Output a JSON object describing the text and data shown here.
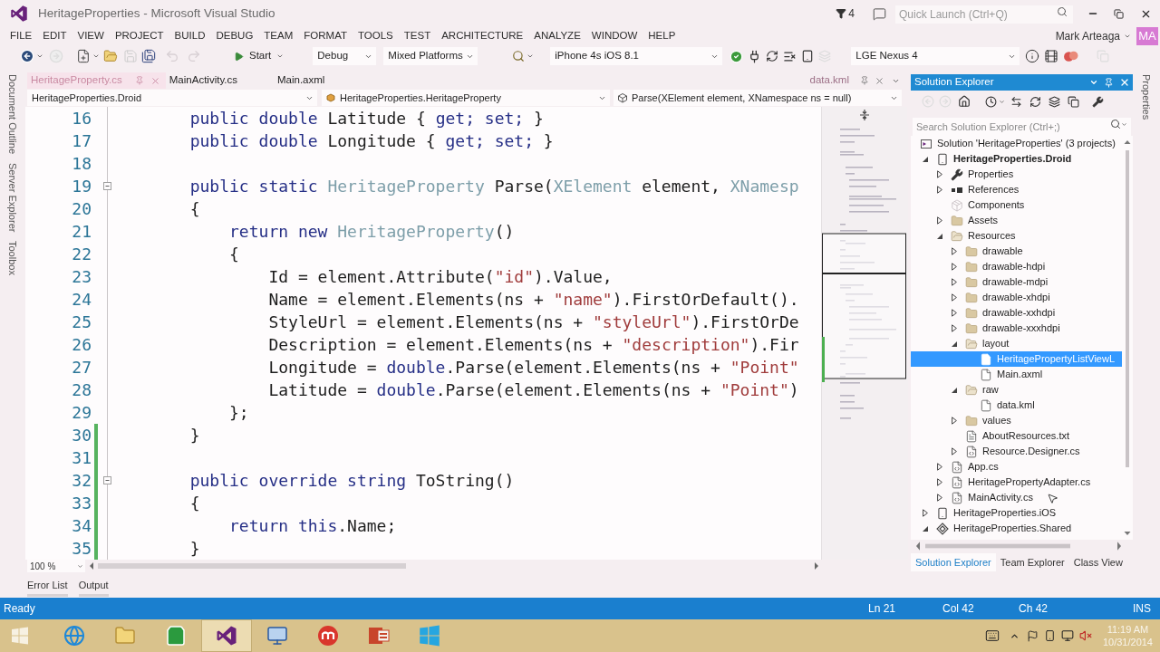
{
  "window": {
    "title": "HeritageProperties - Microsoft Visual Studio",
    "notification_count": "4",
    "quick_launch": {
      "placeholder": "Quick Launch (Ctrl+Q)"
    }
  },
  "menu": [
    "FILE",
    "EDIT",
    "VIEW",
    "PROJECT",
    "BUILD",
    "DEBUG",
    "TEAM",
    "FORMAT",
    "TOOLS",
    "TEST",
    "ARCHITECTURE",
    "ANALYZE",
    "WINDOW",
    "HELP"
  ],
  "account": {
    "name": "Mark Arteaga",
    "initials": "MA"
  },
  "toolbar": {
    "start": "Start",
    "configuration": "Debug",
    "platform": "Mixed Platforms",
    "ios_target": "iPhone 4s iOS 8.1",
    "android_target": "LGE Nexus 4"
  },
  "left_tool_tabs": [
    "Document Outline",
    "Server Explorer",
    "Toolbox"
  ],
  "right_tool_tabs": [
    "Properties"
  ],
  "editor": {
    "tabs": [
      {
        "label": "HeritageProperty.cs",
        "selected": true
      },
      {
        "label": "MainActivity.cs",
        "selected": false
      },
      {
        "label": "Main.axml",
        "selected": false
      }
    ],
    "preview_tab": "data.kml",
    "navigation": [
      "HeritageProperties.Droid",
      "HeritageProperties.HeritageProperty",
      "Parse(XElement element, XNamespace ns = null)"
    ],
    "lines": [
      {
        "number": "16",
        "modified": false,
        "collapsible": false,
        "tokens": [
          {
            "kind": "keyword",
            "text": "        public double"
          },
          {
            "kind": "plain",
            "text": " Latitude { "
          },
          {
            "kind": "keyword",
            "text": "get; set;"
          },
          {
            "kind": "plain",
            "text": " }"
          }
        ]
      },
      {
        "number": "17",
        "modified": false,
        "collapsible": false,
        "tokens": [
          {
            "kind": "keyword",
            "text": "        public double"
          },
          {
            "kind": "plain",
            "text": " Longitude { "
          },
          {
            "kind": "keyword",
            "text": "get; set;"
          },
          {
            "kind": "plain",
            "text": " }"
          }
        ]
      },
      {
        "number": "18",
        "modified": false,
        "collapsible": false
      },
      {
        "number": "19",
        "modified": false,
        "collapsible": true,
        "tokens": [
          {
            "kind": "keyword",
            "text": "        public static "
          },
          {
            "kind": "type",
            "text": "HeritageProperty"
          },
          {
            "kind": "plain",
            "text": " Parse("
          },
          {
            "kind": "type",
            "text": "XElement"
          },
          {
            "kind": "plain",
            "text": " element, "
          },
          {
            "kind": "type",
            "text": "XNamesp"
          }
        ]
      },
      {
        "number": "20",
        "modified": false,
        "collapsible": false,
        "tokens": [
          {
            "kind": "plain",
            "text": "        {"
          }
        ]
      },
      {
        "number": "21",
        "modified": false,
        "collapsible": false,
        "tokens": [
          {
            "kind": "keyword",
            "text": "            return new "
          },
          {
            "kind": "type",
            "text": "HeritageProperty"
          },
          {
            "kind": "plain",
            "text": "()"
          }
        ]
      },
      {
        "number": "22",
        "modified": false,
        "collapsible": false,
        "tokens": [
          {
            "kind": "plain",
            "text": "            {"
          }
        ]
      },
      {
        "number": "23",
        "modified": false,
        "collapsible": false,
        "tokens": [
          {
            "kind": "plain",
            "text": "                Id = element.Attribute("
          },
          {
            "kind": "string",
            "text": "\"id\""
          },
          {
            "kind": "plain",
            "text": ").Value,"
          }
        ]
      },
      {
        "number": "24",
        "modified": false,
        "collapsible": false,
        "tokens": [
          {
            "kind": "plain",
            "text": "                Name = element.Elements(ns + "
          },
          {
            "kind": "string",
            "text": "\"name\""
          },
          {
            "kind": "plain",
            "text": ").FirstOrDefault()."
          }
        ]
      },
      {
        "number": "25",
        "modified": false,
        "collapsible": false,
        "tokens": [
          {
            "kind": "plain",
            "text": "                StyleUrl = element.Elements(ns + "
          },
          {
            "kind": "string",
            "text": "\"styleUrl\""
          },
          {
            "kind": "plain",
            "text": ").FirstOrDe"
          }
        ]
      },
      {
        "number": "26",
        "modified": false,
        "collapsible": false,
        "tokens": [
          {
            "kind": "plain",
            "text": "                Description = element.Elements(ns + "
          },
          {
            "kind": "string",
            "text": "\"description\""
          },
          {
            "kind": "plain",
            "text": ").Fir"
          }
        ]
      },
      {
        "number": "27",
        "modified": false,
        "collapsible": false,
        "tokens": [
          {
            "kind": "plain",
            "text": "                Longitude = "
          },
          {
            "kind": "keyword",
            "text": "double"
          },
          {
            "kind": "plain",
            "text": ".Parse(element.Elements(ns + "
          },
          {
            "kind": "string",
            "text": "\"Point\""
          }
        ]
      },
      {
        "number": "28",
        "modified": false,
        "collapsible": false,
        "tokens": [
          {
            "kind": "plain",
            "text": "                Latitude = "
          },
          {
            "kind": "keyword",
            "text": "double"
          },
          {
            "kind": "plain",
            "text": ".Parse(element.Elements(ns + "
          },
          {
            "kind": "string",
            "text": "\"Point\""
          },
          {
            "kind": "plain",
            "text": ")"
          }
        ]
      },
      {
        "number": "29",
        "modified": false,
        "collapsible": false,
        "tokens": [
          {
            "kind": "plain",
            "text": "            };"
          }
        ]
      },
      {
        "number": "30",
        "modified": true,
        "collapsible": false,
        "tokens": [
          {
            "kind": "plain",
            "text": "        }"
          }
        ]
      },
      {
        "number": "31",
        "modified": true,
        "collapsible": false
      },
      {
        "number": "32",
        "modified": true,
        "collapsible": true,
        "tokens": [
          {
            "kind": "keyword",
            "text": "        public override string"
          },
          {
            "kind": "plain",
            "text": " ToString()"
          }
        ]
      },
      {
        "number": "33",
        "modified": true,
        "collapsible": false,
        "tokens": [
          {
            "kind": "plain",
            "text": "        {"
          }
        ]
      },
      {
        "number": "34",
        "modified": true,
        "collapsible": false,
        "tokens": [
          {
            "kind": "keyword",
            "text": "            return this"
          },
          {
            "kind": "plain",
            "text": ".Name;"
          }
        ]
      },
      {
        "number": "35",
        "modified": true,
        "collapsible": false,
        "tokens": [
          {
            "kind": "plain",
            "text": "        }"
          }
        ]
      }
    ],
    "zoom": "100 %"
  },
  "bottom_tool_tabs": [
    "Error List",
    "Output"
  ],
  "solution_explorer": {
    "title": "Solution Explorer",
    "search": {
      "placeholder": "Search Solution Explorer (Ctrl+;)"
    },
    "tree": [
      {
        "label": "Solution 'HeritageProperties' (3 projects)",
        "kind": "solution",
        "selected": false,
        "children": [
          {
            "label": "HeritageProperties.Droid",
            "kind": "project",
            "startup": true,
            "expanded": true,
            "selected": false,
            "children": [
              {
                "label": "Properties",
                "kind": "properties",
                "expanded": false,
                "selected": false
              },
              {
                "label": "References",
                "kind": "references",
                "expanded": false,
                "selected": false
              },
              {
                "label": "Components",
                "kind": "components",
                "selected": false
              },
              {
                "label": "Assets",
                "kind": "folder",
                "expanded": false,
                "selected": false
              },
              {
                "label": "Resources",
                "kind": "folder",
                "expanded": true,
                "selected": false,
                "children": [
                  {
                    "label": "drawable",
                    "kind": "folder",
                    "expanded": false,
                    "selected": false
                  },
                  {
                    "label": "drawable-hdpi",
                    "kind": "folder",
                    "expanded": false,
                    "selected": false
                  },
                  {
                    "label": "drawable-mdpi",
                    "kind": "folder",
                    "expanded": false,
                    "selected": false
                  },
                  {
                    "label": "drawable-xhdpi",
                    "kind": "folder",
                    "expanded": false,
                    "selected": false
                  },
                  {
                    "label": "drawable-xxhdpi",
                    "kind": "folder",
                    "expanded": false,
                    "selected": false
                  },
                  {
                    "label": "drawable-xxxhdpi",
                    "kind": "folder",
                    "expanded": false,
                    "selected": false
                  },
                  {
                    "label": "layout",
                    "kind": "folder",
                    "expanded": true,
                    "selected": false,
                    "children": [
                      {
                        "label": "HeritagePropertyListViewL",
                        "kind": "file",
                        "selected": true
                      },
                      {
                        "label": "Main.axml",
                        "kind": "file",
                        "selected": false
                      }
                    ]
                  },
                  {
                    "label": "raw",
                    "kind": "folder",
                    "expanded": true,
                    "selected": false,
                    "children": [
                      {
                        "label": "data.kml",
                        "kind": "file",
                        "selected": false
                      }
                    ]
                  },
                  {
                    "label": "values",
                    "kind": "folder",
                    "expanded": false,
                    "selected": false
                  },
                  {
                    "label": "AboutResources.txt",
                    "kind": "text-file",
                    "selected": false
                  },
                  {
                    "label": "Resource.Designer.cs",
                    "kind": "code-file",
                    "expanded": false,
                    "selected": false
                  }
                ]
              },
              {
                "label": "App.cs",
                "kind": "code-file",
                "expanded": false,
                "selected": false
              },
              {
                "label": "HeritagePropertyAdapter.cs",
                "kind": "code-file",
                "expanded": false,
                "selected": false
              },
              {
                "label": "MainActivity.cs",
                "kind": "code-file",
                "expanded": false,
                "selected": false
              }
            ]
          },
          {
            "label": "HeritageProperties.iOS",
            "kind": "project",
            "startup": false,
            "expanded": false,
            "selected": false
          },
          {
            "label": "HeritageProperties.Shared",
            "kind": "shared-project",
            "expanded": true,
            "selected": false
          }
        ]
      }
    ],
    "tabs": [
      {
        "label": "Solution Explorer",
        "selected": true
      },
      {
        "label": "Team Explorer",
        "selected": false
      },
      {
        "label": "Class View",
        "selected": false
      }
    ]
  },
  "status_bar": {
    "state": "Ready",
    "line": "Ln 21",
    "column": "Col 42",
    "character": "Ch 42",
    "mode": "INS"
  },
  "taskbar": {
    "apps": [
      {
        "selected": false
      },
      {
        "selected": false
      },
      {
        "selected": false
      },
      {
        "selected": true
      },
      {
        "selected": false
      },
      {
        "selected": false
      },
      {
        "selected": false
      },
      {
        "selected": false
      }
    ],
    "time": "11:19 AM",
    "date": "10/31/2014"
  }
}
